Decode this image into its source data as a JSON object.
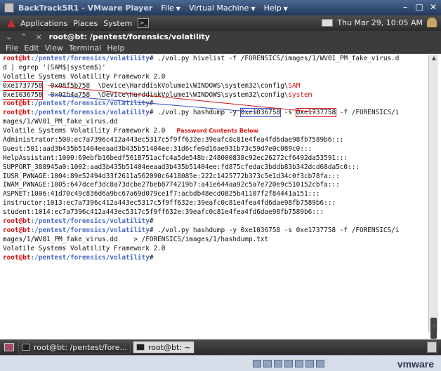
{
  "vm_window": {
    "title": "BackTrack5R1 - VMware Player",
    "menus": [
      "File",
      "Virtual Machine",
      "Help"
    ]
  },
  "panel": {
    "applications": "Applications",
    "places": "Places",
    "system": "System",
    "clock": "Thu Mar 29, 10:05 AM"
  },
  "terminal": {
    "title": "root@bt: /pentest/forensics/volatility",
    "menu": [
      "File",
      "Edit",
      "View",
      "Terminal",
      "Help"
    ],
    "prompt_user": "root@bt",
    "prompt_path": ":/pentest/forensics/volatility",
    "hivelist_cmd": "# ./vol.py hivelist -f /FORENSICS/images/1/WV01_PM_fake_virus.d",
    "hivelist_cmd_cont": "d | egrep '(SAM$|system$)'",
    "banner": "Volatile Systems Volatility Framework 2.0",
    "sam_virt": "0xe1737758",
    "sam_phys": "  0x08f5b758  \\Device\\HarddiskVolume1\\WINDOWS\\system32\\config\\",
    "sam_name": "SAM",
    "sys_virt": "0xe1036758",
    "sys_phys": "  0x02b4a758  \\Device\\HarddiskVolume1\\WINDOWS\\system32\\config\\",
    "sys_name": "system",
    "hashdump1_a": "# ./vol.py hashdump -y ",
    "hashdump1_y": "0xe1036758",
    "hashdump1_b": " -s ",
    "hashdump1_s": "0xe1737758",
    "hashdump1_c": " -f /FORENSICS/i",
    "hashdump1_cont": "mages/1/WV01_PM_fake_virus.dd",
    "annotation": "Password Contents Below",
    "hashes": [
      "Administrator:500:ec7a7396c412a443ec5317c5f9ff632e:39eafc0c81e4fea4fd6dae98fb7589b6:::",
      "Guest:501:aad3b435b51404eeaad3b435b51404ee:31d6cfe0d16ae931b73c59d7e0c089c0:::",
      "HelpAssistant:1000:69ebfb16bedf5618751acfc4a5de548b:248000838c92ec26272cf6492da53591:::",
      "SUPPORT_388945a0:1002:aad3b435b51404eeaad3b435b51404ee:fd875cfedac3bddb83b342dcd68da5c0:::",
      "IUSR_PWNAGE:1004:89e52494d33f2611a562090c6418085e:222c1425772b373c5e1d34c0f3cb78fa:::",
      "IWAM_PWNAGE:1005:647dcef3dc8a73dcbe27beb8774219b7:a41e644aa92c5a7e720e9c510152cbfa:::",
      "ASPNET:1006:41d70c49c836d6a9bc67a69d079ce1f7:acbdb48ecd0825b41107f2f84441a151:::",
      "instructor:1013:ec7a7396c412a443ec5317c5f9ff632e:39eafc0c81e4fea4fd6dae98fb7589b6:::",
      "student:1014:ec7a7396c412a443ec5317c5f9ff632e:39eafc0c81e4fea4fd6dae98fb7589b6:::"
    ],
    "hashdump2": "# ./vol.py hashdump -y 0xe1036758 -s 0xe1737758 -f /FORENSICS/i",
    "hashdump2_cont": "mages/1/WV01_PM_fake_virus.dd    > /FORENSICS/images/1/hashdump.txt",
    "final_suffix": "# "
  },
  "taskbar": {
    "task1": "root@bt: /pentest/fore...",
    "task2": "root@bt: ~"
  },
  "statusbar": {
    "logo": "vmware"
  }
}
